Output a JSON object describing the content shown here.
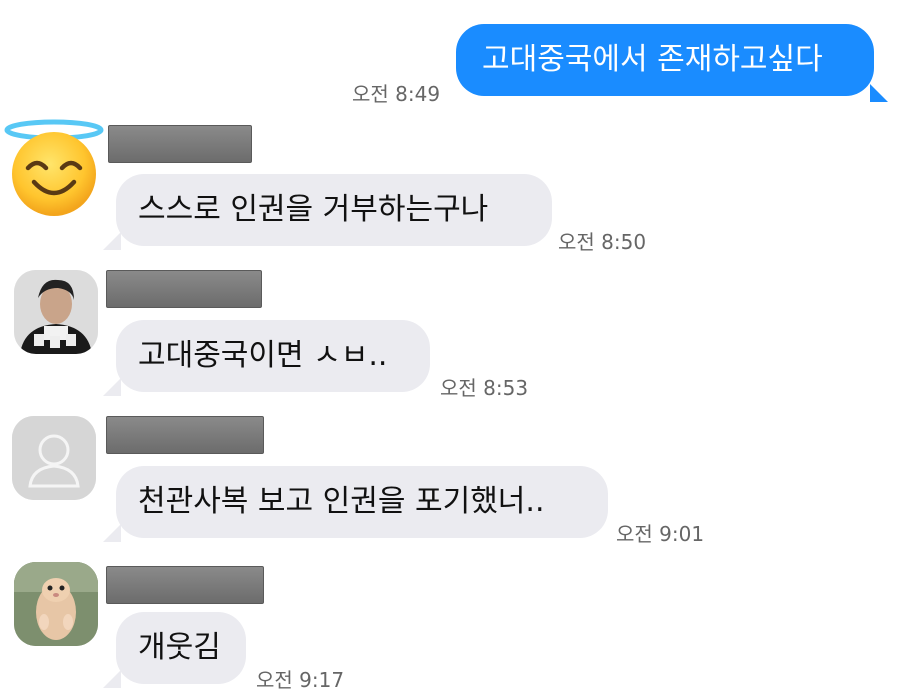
{
  "messages": {
    "m1": {
      "text": "고대중국에서 존재하고싶다",
      "time": "오전 8:49"
    },
    "m2": {
      "text": "스스로 인권을 거부하는구나",
      "time": "오전 8:50"
    },
    "m3": {
      "text": "고대중국이면 ㅅㅂ..",
      "time": "오전 8:53"
    },
    "m4": {
      "text": "천관사복 보고 인권을 포기했너..",
      "time": "오전 9:01"
    },
    "m5": {
      "text": "개웃김",
      "time": "오전 9:17"
    }
  },
  "avatars": {
    "a1": "smiling-halo-emoji-icon",
    "a2": "person-photo",
    "a3": "default-profile-icon",
    "a4": "hamster-photo"
  },
  "colors": {
    "outgoing_bubble": "#1a8cff",
    "incoming_bubble": "#ebebf0",
    "redaction": "#7a7a7a"
  }
}
